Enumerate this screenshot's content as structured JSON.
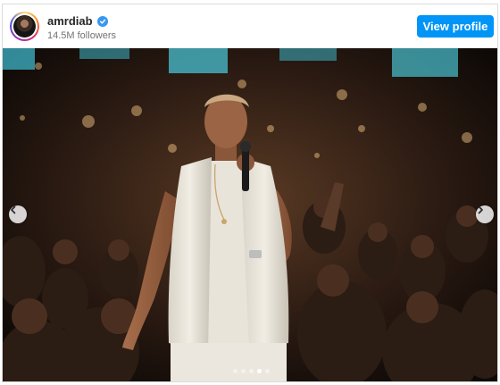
{
  "post": {
    "username": "amrdiab",
    "followers": "14.5M followers",
    "verified": true,
    "view_profile_label": "View profile"
  },
  "carousel": {
    "slide_count": 5,
    "active_index": 3,
    "prev_icon": "chevron-left-icon",
    "next_icon": "chevron-right-icon"
  },
  "colors": {
    "accent": "#0095f6",
    "verified": "#3897f0",
    "text_primary": "#262626",
    "text_secondary": "#737373"
  }
}
